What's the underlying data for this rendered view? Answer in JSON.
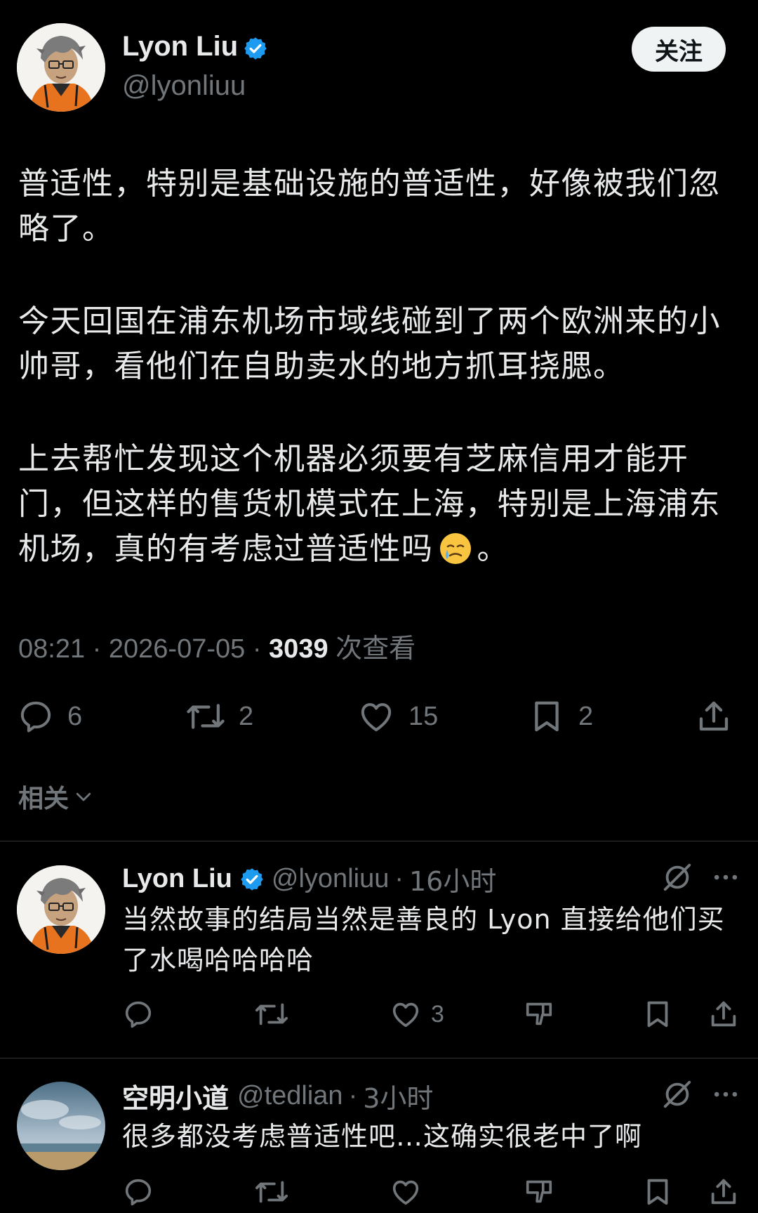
{
  "post": {
    "author": {
      "name": "Lyon Liu",
      "handle": "@lyonliuu",
      "verified": true
    },
    "follow_label": "关注",
    "paragraphs": [
      "普适性，特别是基础设施的普适性，好像被我们忽略了。",
      "今天回国在浦东机场市域线碰到了两个欧洲来的小帅哥，看他们在自助卖水的地方抓耳挠腮。",
      "上去帮忙发现这个机器必须要有芝麻信用才能开门，但这样的售货机模式在上海，特别是上海浦东机场，真的有考虑过普适性吗",
      "。"
    ],
    "emoji": "crying-face",
    "time": "08:21",
    "date": "2026-07-05",
    "views": "3039",
    "views_label": "次查看",
    "sep": "·",
    "actions": {
      "replies": "6",
      "reposts": "2",
      "likes": "15",
      "bookmarks": "2"
    },
    "related_label": "相关"
  },
  "replies": [
    {
      "name": "Lyon Liu",
      "handle": "@lyonliuu",
      "time": "16小时",
      "verified": true,
      "text": "当然故事的结局当然是善良的 Lyon 直接给他们买了水喝哈哈哈哈",
      "likes": "3"
    },
    {
      "name": "空明小道",
      "handle": "@tedlian",
      "time": "3小时",
      "verified": false,
      "text": "很多都没考虑普适性吧…这确实很老中了啊",
      "likes": ""
    }
  ],
  "colors": {
    "background": "#000000",
    "text": "#e7e9ea",
    "muted": "#71767b",
    "divider": "#2f3336",
    "verified": "#1d9bf0",
    "follow_bg": "#eff3f4"
  },
  "icons": [
    "verified-badge-icon",
    "reply-icon",
    "repost-icon",
    "like-icon",
    "bookmark-icon",
    "share-icon",
    "chevron-down-icon",
    "grok-icon",
    "more-icon",
    "downvote-icon"
  ]
}
